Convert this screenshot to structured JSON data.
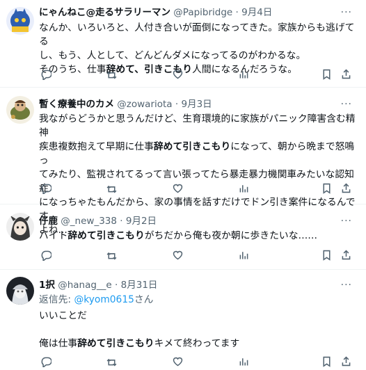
{
  "more_label": "···",
  "tweets": [
    {
      "name": "にゃんねこ@走るサラリーマン",
      "handle": "@Papibridge",
      "sep": "·",
      "date": "9月4日",
      "lines": [
        [
          "なんか、いろいろと、人付き合いが面倒になってきた。家族からも逃げてる"
        ],
        [
          "し、もう、人として、どんどんダメになってるのがわかるな。"
        ],
        [
          "そのうち、仕事",
          "辞めて、引きこもり",
          "人間になるんだろうな。"
        ]
      ],
      "avatar_color": "#2f5fb0"
    },
    {
      "name": "暫く療養中のカメ",
      "handle": "@zowariota",
      "sep": "·",
      "date": "9月3日",
      "lines": [
        [
          "我ながらどうかと思うんだけど、生育環境的に家族がパニック障害含む精神"
        ],
        [
          "疾患複数抱えて早期に仕事",
          "辞めて引きこもり",
          "になって、朝から晩まで怒鳴っ"
        ],
        [
          "てみたり、監視されてるって言い張ってたら暴走暴力機関車みたいな認知症"
        ],
        [
          "になっちゃたもんだから、家の事情を話すだけでドン引き案件になるんです"
        ],
        [
          "よね..."
        ]
      ],
      "avatar_color": "#6e7b3a"
    },
    {
      "name": "仔鹿",
      "handle": "@_new_338",
      "sep": "·",
      "date": "9月2日",
      "lines": [
        [
          "バイト",
          "辞めて引きこもり",
          "がちだから俺も夜か朝に歩きたいな……"
        ]
      ],
      "avatar_color": "#3a3a3a"
    },
    {
      "name": "1択",
      "handle": "@hanag__e",
      "sep": "·",
      "date": "8月31日",
      "reply_label": "返信先: ",
      "reply_handle": "@kyom0615",
      "reply_suffix": "さん",
      "lines": [
        [
          "いいことだ"
        ],
        [
          ""
        ],
        [
          "俺は仕事",
          "辞めて引きこもり",
          "キメて終わってます"
        ]
      ],
      "avatar_color": "#9aa3ad"
    }
  ],
  "action_icons": [
    "reply-icon",
    "retweet-icon",
    "like-icon",
    "views-icon",
    "bookmark-icon",
    "share-icon"
  ]
}
